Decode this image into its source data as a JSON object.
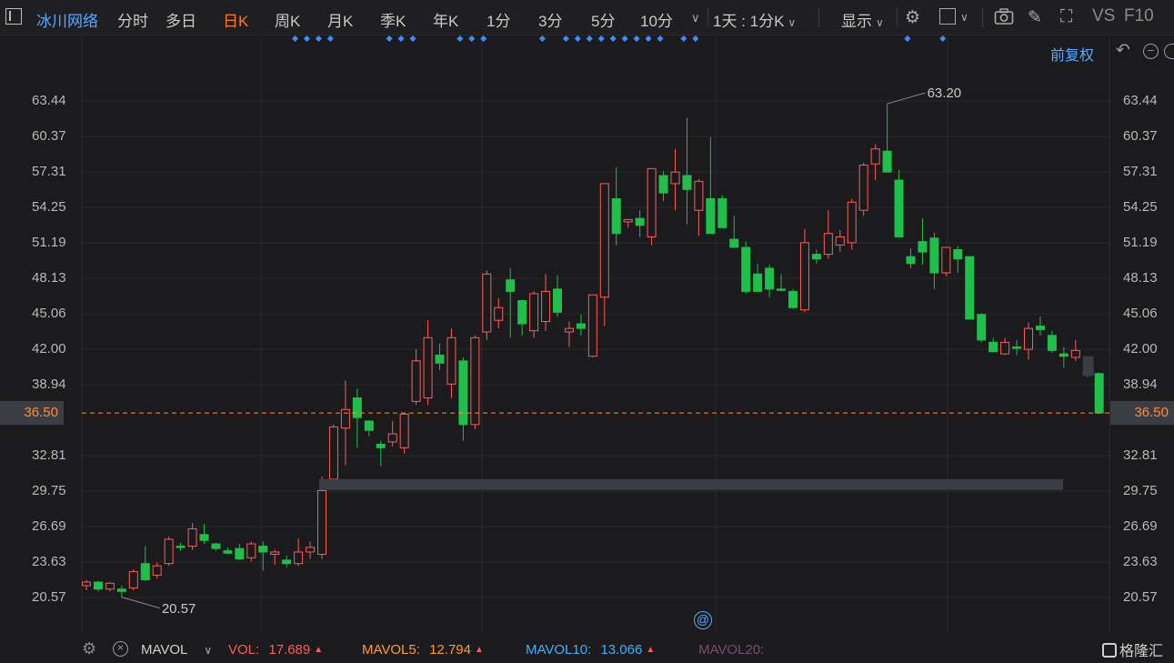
{
  "toolbar": {
    "stock_name": "冰川网络",
    "periods": [
      "分时",
      "多日",
      "日K",
      "周K",
      "月K",
      "季K",
      "年K",
      "1分",
      "3分",
      "5分",
      "10分"
    ],
    "active_period": "日K",
    "range_selector": "1天 : 1分K",
    "display_label": "显示",
    "vs_label": "VS",
    "f10_label": "F10"
  },
  "chart_header": {
    "adjust_label": "前复权"
  },
  "colors": {
    "up": "#ff5a5a",
    "down": "#1fbf4a",
    "marker": "#3f8cff",
    "last_price": "#ff8a3d",
    "accent": "#ff7a21"
  },
  "chart_data": {
    "type": "candlestick",
    "ylim": [
      18.5,
      66.5
    ],
    "y_ticks": [
      "63.44",
      "60.37",
      "57.31",
      "54.25",
      "51.19",
      "48.13",
      "45.06",
      "42.00",
      "38.94",
      "32.81",
      "29.75",
      "26.69",
      "23.63",
      "20.57"
    ],
    "last_price": "36.50",
    "high_annotation": "63.20",
    "low_annotation": "20.57",
    "ohlc": [
      [
        21.6,
        22.1,
        21.2,
        21.9
      ],
      [
        21.9,
        22.0,
        21.1,
        21.3
      ],
      [
        21.3,
        21.9,
        21.1,
        21.8
      ],
      [
        21.3,
        21.6,
        20.6,
        21.1
      ],
      [
        21.4,
        23.0,
        21.2,
        22.8
      ],
      [
        23.5,
        25.0,
        22.0,
        22.1
      ],
      [
        22.5,
        23.6,
        22.2,
        23.3
      ],
      [
        23.5,
        25.8,
        23.3,
        25.6
      ],
      [
        25.0,
        25.3,
        24.6,
        24.9
      ],
      [
        25.0,
        27.0,
        24.7,
        26.5
      ],
      [
        26.0,
        26.9,
        25.2,
        25.5
      ],
      [
        25.2,
        25.3,
        24.6,
        24.8
      ],
      [
        24.6,
        24.9,
        24.3,
        24.4
      ],
      [
        24.8,
        25.2,
        23.8,
        23.9
      ],
      [
        24.0,
        25.4,
        23.7,
        25.2
      ],
      [
        25.0,
        25.4,
        22.9,
        24.5
      ],
      [
        24.3,
        24.7,
        23.4,
        24.5
      ],
      [
        23.8,
        24.2,
        23.2,
        23.5
      ],
      [
        23.5,
        25.7,
        23.3,
        24.5
      ],
      [
        24.5,
        25.4,
        23.9,
        24.9
      ],
      [
        24.3,
        31.0,
        23.9,
        29.8
      ],
      [
        30.8,
        35.5,
        30.5,
        35.3
      ],
      [
        35.2,
        39.3,
        32.0,
        36.8
      ],
      [
        37.8,
        38.6,
        33.5,
        36.1
      ],
      [
        35.8,
        35.9,
        34.5,
        35.0
      ],
      [
        33.8,
        34.1,
        31.9,
        33.5
      ],
      [
        34.0,
        35.8,
        33.6,
        34.7
      ],
      [
        33.5,
        36.5,
        33.0,
        36.4
      ],
      [
        37.5,
        42.0,
        37.2,
        41.0
      ],
      [
        37.8,
        44.5,
        37.2,
        43.0
      ],
      [
        41.5,
        42.5,
        40.2,
        40.8
      ],
      [
        39.0,
        43.8,
        37.8,
        43.0
      ],
      [
        41.0,
        41.3,
        34.1,
        35.5
      ],
      [
        35.5,
        43.2,
        35.1,
        43.0
      ],
      [
        43.5,
        48.8,
        42.8,
        48.5
      ],
      [
        44.5,
        46.4,
        43.8,
        45.6
      ],
      [
        48.0,
        49.0,
        43.0,
        47.0
      ],
      [
        46.2,
        46.3,
        43.2,
        44.2
      ],
      [
        43.6,
        47.0,
        43.0,
        46.8
      ],
      [
        44.4,
        48.5,
        43.6,
        47.0
      ],
      [
        47.2,
        48.4,
        44.8,
        45.2
      ],
      [
        43.5,
        44.4,
        42.2,
        43.8
      ],
      [
        44.2,
        45.0,
        43.2,
        43.8
      ],
      [
        41.4,
        46.0,
        41.3,
        46.7
      ],
      [
        46.5,
        47.0,
        44.0,
        56.3
      ],
      [
        55.0,
        57.7,
        51.0,
        52.0
      ],
      [
        53.0,
        53.2,
        52.5,
        53.2
      ],
      [
        53.3,
        54.0,
        51.7,
        52.7
      ],
      [
        51.7,
        57.6,
        51.0,
        57.6
      ],
      [
        57.0,
        57.4,
        54.8,
        55.5
      ],
      [
        56.3,
        59.3,
        54.0,
        57.3
      ],
      [
        57.0,
        62.0,
        52.8,
        55.8
      ],
      [
        54.0,
        56.7,
        51.8,
        56.5
      ],
      [
        55.0,
        60.3,
        52.0,
        52.0
      ],
      [
        55.0,
        55.3,
        53.0,
        52.5
      ],
      [
        51.5,
        53.5,
        51.0,
        50.8
      ],
      [
        50.8,
        51.3,
        46.8,
        47.0
      ],
      [
        48.5,
        49.4,
        47.0,
        47.0
      ],
      [
        49.0,
        49.3,
        46.5,
        47.2
      ],
      [
        47.2,
        48.5,
        47.0,
        47.1
      ],
      [
        47.0,
        47.2,
        45.5,
        45.6
      ],
      [
        45.4,
        52.4,
        45.2,
        51.2
      ],
      [
        50.2,
        50.6,
        49.4,
        49.8
      ],
      [
        50.2,
        54.0,
        49.8,
        52.0
      ],
      [
        51.0,
        52.3,
        50.4,
        51.7
      ],
      [
        51.2,
        55.0,
        50.6,
        54.7
      ],
      [
        54.0,
        58.1,
        53.5,
        57.9
      ],
      [
        58.0,
        59.7,
        56.6,
        59.3
      ],
      [
        59.1,
        63.2,
        57.7,
        57.3
      ],
      [
        56.6,
        57.5,
        51.7,
        51.7
      ],
      [
        50.0,
        50.7,
        49.0,
        49.4
      ],
      [
        51.3,
        53.3,
        49.3,
        50.4
      ],
      [
        51.6,
        52.1,
        47.2,
        48.6
      ],
      [
        48.6,
        50.7,
        48.3,
        50.8
      ],
      [
        50.6,
        50.9,
        48.6,
        49.8
      ],
      [
        50.0,
        50.0,
        44.9,
        44.6
      ],
      [
        45.0,
        45.1,
        42.6,
        42.8
      ],
      [
        42.6,
        43.0,
        41.7,
        41.8
      ],
      [
        41.6,
        43.0,
        41.5,
        42.6
      ],
      [
        42.2,
        42.8,
        41.5,
        42.1
      ],
      [
        42.0,
        44.3,
        41.1,
        43.8
      ],
      [
        44.0,
        44.8,
        43.2,
        43.7
      ],
      [
        43.2,
        43.6,
        41.7,
        41.9
      ],
      [
        41.6,
        42.2,
        40.4,
        41.4
      ],
      [
        41.3,
        42.8,
        41.0,
        41.9
      ],
      [
        40.1,
        41.3,
        39.6,
        39.9
      ],
      [
        39.9,
        40.0,
        36.5,
        36.5
      ]
    ],
    "marker_groups": [
      [
        0,
        3
      ],
      [
        8,
        10
      ],
      [
        14,
        16
      ],
      [
        21,
        21
      ],
      [
        23,
        31
      ],
      [
        33,
        34
      ],
      [
        52,
        52
      ],
      [
        55,
        55
      ],
      [
        68,
        68
      ]
    ]
  },
  "volume_bar": {
    "indicator": "MAVOL",
    "vol_label": "VOL:",
    "vol_value": "17.689",
    "mavol5_label": "MAVOL5:",
    "mavol5_value": "12.794",
    "mavol10_label": "MAVOL10:",
    "mavol10_value": "13.066",
    "mavol20_label": "MAVOL20:"
  },
  "brand": {
    "name": "格隆汇"
  }
}
